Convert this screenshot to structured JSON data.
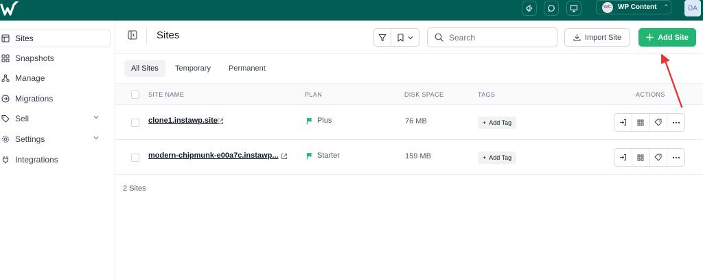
{
  "topbar": {
    "workspace_initials": "WC",
    "workspace_name": "WP Content",
    "user_initials": "DA"
  },
  "sidebar": {
    "items": [
      {
        "label": "Sites",
        "icon": "layout-icon",
        "active": true
      },
      {
        "label": "Snapshots",
        "icon": "grid-icon"
      },
      {
        "label": "Manage",
        "icon": "nodes-icon"
      },
      {
        "label": "Migrations",
        "icon": "arrow-circle-icon"
      },
      {
        "label": "Sell",
        "icon": "tag-icon",
        "expandable": true
      },
      {
        "label": "Settings",
        "icon": "gear-icon",
        "expandable": true
      },
      {
        "label": "Integrations",
        "icon": "plug-icon"
      }
    ]
  },
  "header": {
    "title": "Sites",
    "search_placeholder": "Search",
    "import_label": "Import Site",
    "add_label": "Add Site"
  },
  "tabs": [
    {
      "label": "All Sites",
      "active": true
    },
    {
      "label": "Temporary"
    },
    {
      "label": "Permanent"
    }
  ],
  "table": {
    "columns": {
      "site_name": "SITE NAME",
      "plan": "PLAN",
      "disk_space": "DISK SPACE",
      "tags": "TAGS",
      "actions": "ACTIONS"
    },
    "rows": [
      {
        "site": "clone1.instawp.site",
        "plan": "Plus",
        "disk": "76 MB",
        "tag_label": "Add Tag"
      },
      {
        "site": "modern-chipmunk-e00a7c.instawp...",
        "plan": "Starter",
        "disk": "159 MB",
        "tag_label": "Add Tag"
      }
    ],
    "footer": "2 Sites"
  },
  "colors": {
    "brand": "#005e54",
    "accent": "#22b573",
    "annotation": "#e53935"
  }
}
